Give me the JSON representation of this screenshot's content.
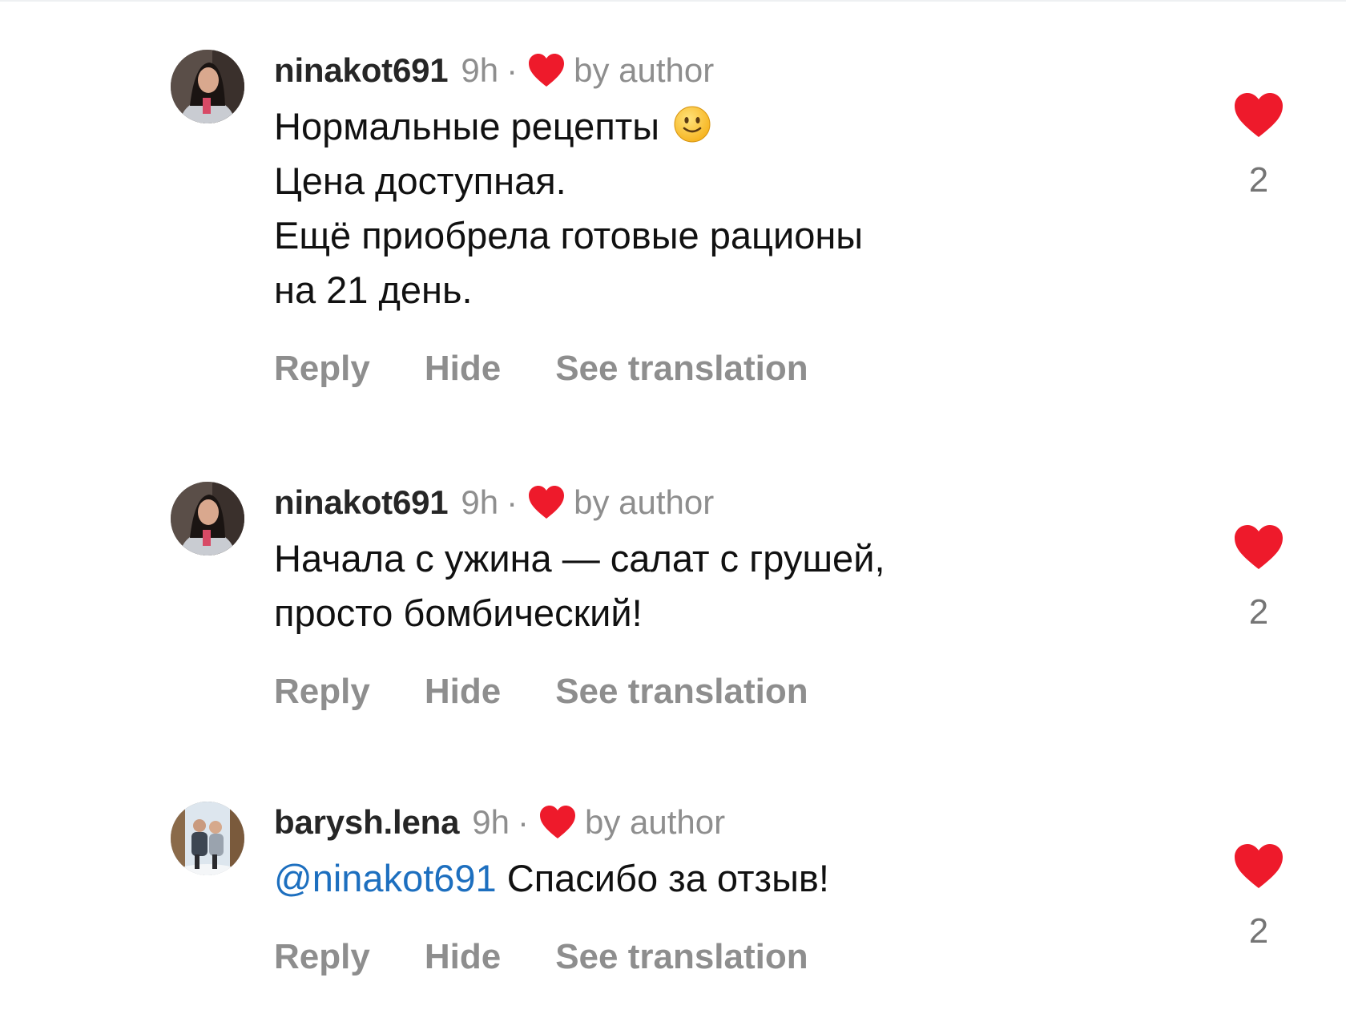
{
  "comments": [
    {
      "username": "ninakot691",
      "time": "9h",
      "separator": "·",
      "liked_by_label": "by author",
      "lines": [
        "Нормальные рецепты",
        "Цена доступная.",
        "Ещё приобрела готовые рационы",
        "на 21 день."
      ],
      "mention": "",
      "emoji": "slightly-smiling-face",
      "actions": {
        "reply": "Reply",
        "hide": "Hide",
        "translate": "See translation"
      },
      "like_count": "2"
    },
    {
      "username": "ninakot691",
      "time": "9h",
      "separator": "·",
      "liked_by_label": "by author",
      "lines": [
        "Начала с ужина — салат с грушей,",
        "просто бомбический!"
      ],
      "mention": "",
      "actions": {
        "reply": "Reply",
        "hide": "Hide",
        "translate": "See translation"
      },
      "like_count": "2"
    },
    {
      "username": "barysh.lena",
      "time": "9h",
      "separator": "·",
      "liked_by_label": "by author",
      "mention": "@ninakot691",
      "lines": [
        "Спасибо за отзыв!"
      ],
      "actions": {
        "reply": "Reply",
        "hide": "Hide",
        "translate": "See translation"
      },
      "like_count": "2"
    }
  ],
  "colors": {
    "heart": "#ee1a2b",
    "meta_gray": "#8e8e8e",
    "mention_blue": "#1d6fbf",
    "text": "#111111"
  }
}
